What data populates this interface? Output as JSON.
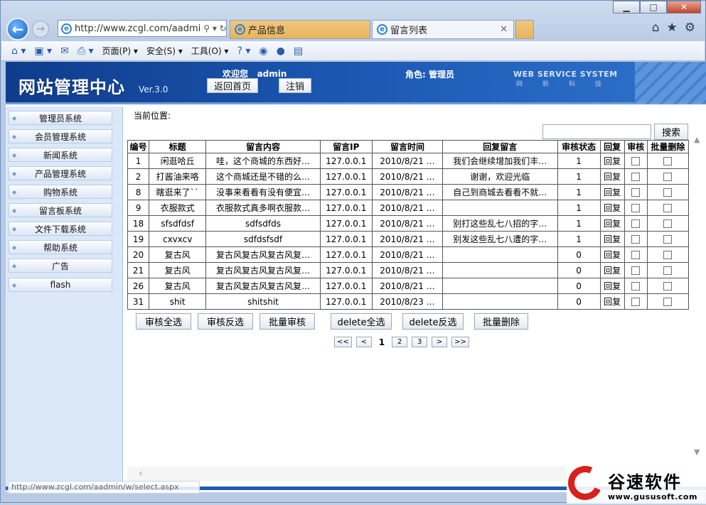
{
  "browser": {
    "url": "http://www.zcgl.com/aadmi",
    "tabs": [
      {
        "label": "产品信息"
      },
      {
        "label": "留言列表"
      }
    ],
    "title_buttons": {
      "minimize": "▁",
      "maximize": "□",
      "close": "✕"
    },
    "command_bar": {
      "page": "页面(P) ▾",
      "safety": "安全(S) ▾",
      "tools": "工具(O) ▾"
    },
    "status_url": "http://www.zcgl.com/aadmin/w/select.aspx"
  },
  "header": {
    "logo": "网站管理中心",
    "version": "Ver.3.0",
    "welcome_prefix": "欢迎您",
    "username": "admin",
    "home_button": "返回首页",
    "logout_button": "注销",
    "role": "角色: 管理员",
    "tagline": "WEB SERVICE SYSTEM",
    "tagline_cn": "网新科技"
  },
  "sidebar": {
    "items": [
      {
        "label": "管理员系统"
      },
      {
        "label": "会员管理系统"
      },
      {
        "label": "新闻系统"
      },
      {
        "label": "产品管理系统"
      },
      {
        "label": "购物系统"
      },
      {
        "label": "留言板系统"
      },
      {
        "label": "文件下载系统"
      },
      {
        "label": "帮助系统"
      },
      {
        "label": "广告"
      },
      {
        "label": "flash"
      }
    ]
  },
  "main": {
    "location_label": "当前位置:",
    "search_value": "",
    "search_button": "搜索",
    "columns": [
      "编号",
      "标题",
      "留言内容",
      "留言IP",
      "留言时间",
      "回复留言",
      "审核状态",
      "回复",
      "审核",
      "批量删除"
    ],
    "rows": [
      {
        "id": "1",
        "title": "闲逛哈丘",
        "content": "哇，这个商城的东西好…",
        "ip": "127.0.0.1",
        "time": "2010/8/21 …",
        "reply": "我们会继续增加我们丰…",
        "status": "1",
        "reply_link": "回复"
      },
      {
        "id": "2",
        "title": "打酱油来咯",
        "content": "这个商城还是不错的么…",
        "ip": "127.0.0.1",
        "time": "2010/8/21 …",
        "reply": "谢谢，欢迎光临",
        "status": "1",
        "reply_link": "回复"
      },
      {
        "id": "8",
        "title": "瞎逛来了``",
        "content": "没事来看看有没有便宜…",
        "ip": "127.0.0.1",
        "time": "2010/8/21 …",
        "reply": "自己到商城去看看不就…",
        "status": "1",
        "reply_link": "回复"
      },
      {
        "id": "9",
        "title": "衣服款式",
        "content": "衣服款式真多啊衣服款…",
        "ip": "127.0.0.1",
        "time": "2010/8/21 …",
        "reply": "",
        "status": "1",
        "reply_link": "回复"
      },
      {
        "id": "18",
        "title": "sfsdfdsf",
        "content": "sdfsdfds",
        "ip": "127.0.0.1",
        "time": "2010/8/21 …",
        "reply": "别打这些乱七八招的字…",
        "status": "1",
        "reply_link": "回复"
      },
      {
        "id": "19",
        "title": "cxvxcv",
        "content": "sdfdsfsdf",
        "ip": "127.0.0.1",
        "time": "2010/8/21 …",
        "reply": "别发这些乱七八遭的字…",
        "status": "1",
        "reply_link": "回复"
      },
      {
        "id": "20",
        "title": "复古风",
        "content": "复古风复古风复古风复…",
        "ip": "127.0.0.1",
        "time": "2010/8/21 …",
        "reply": "",
        "status": "0",
        "reply_link": "回复"
      },
      {
        "id": "21",
        "title": "复古风",
        "content": "复古风复古风复古风复…",
        "ip": "127.0.0.1",
        "time": "2010/8/21 …",
        "reply": "",
        "status": "0",
        "reply_link": "回复"
      },
      {
        "id": "26",
        "title": "复古风",
        "content": "复古风复古风复古风复…",
        "ip": "127.0.0.1",
        "time": "2010/8/21 …",
        "reply": "",
        "status": "0",
        "reply_link": "回复"
      },
      {
        "id": "31",
        "title": "shit",
        "content": "shitshit",
        "ip": "127.0.0.1",
        "time": "2010/8/23 …",
        "reply": "",
        "status": "0",
        "reply_link": "回复"
      }
    ],
    "actions": {
      "audit_all": "审核全选",
      "audit_invert": "审核反选",
      "batch_audit": "批量审核",
      "delete_all": "delete全选",
      "delete_invert": "delete反选",
      "batch_delete": "批量删除"
    },
    "pager": {
      "first": "<<",
      "prev": "<",
      "pages": [
        "1",
        "2",
        "3"
      ],
      "current": "1",
      "next": ">",
      "last": ">>"
    }
  },
  "watermark": {
    "name": "谷速软件",
    "url": "www.gususoft.com"
  }
}
